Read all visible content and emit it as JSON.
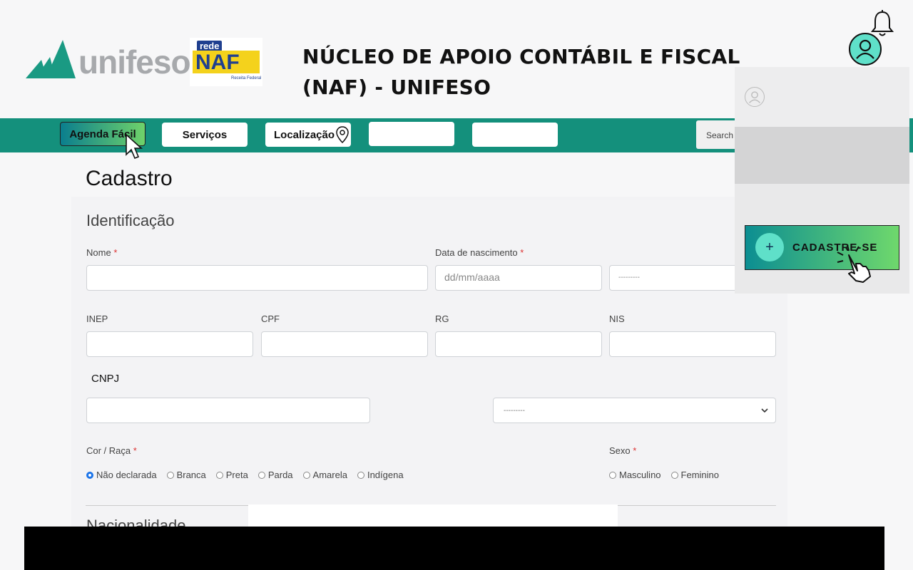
{
  "header": {
    "logo_text": "unifeso",
    "naf_logo_top": "rede",
    "naf_logo_main": "NAF",
    "naf_logo_sub": "Receita Federal",
    "title_line1": "NÚCLEO DE APOIO CONTÁBIL E FISCAL",
    "title_line2": "(NAF) - UNIFESO"
  },
  "nav": {
    "items": [
      "Agenda Fácil",
      "Serviços",
      "Localização",
      "",
      ""
    ],
    "search_placeholder": "Search"
  },
  "form": {
    "page_title": "Cadastro",
    "section_identificacao": "Identificação",
    "labels": {
      "nome": "Nome",
      "data_nascimento": "Data de nascimento",
      "inep": "INEP",
      "cpf": "CPF",
      "rg": "RG",
      "nis": "NIS",
      "cnpj": "CNPJ",
      "cor_raca": "Cor / Raça",
      "sexo": "Sexo"
    },
    "required_marker": "*",
    "date_placeholder": "dd/mm/aaaa",
    "select_placeholder": "---------",
    "cor_raca_options": [
      "Não declarada",
      "Branca",
      "Preta",
      "Parda",
      "Amarela",
      "Indígena"
    ],
    "cor_raca_selected": "Não declarada",
    "sexo_options": [
      "Masculino",
      "Feminino"
    ],
    "section_nacionalidade": "Nacionalidade"
  },
  "panel": {
    "signup_label": "CADASTRE-SE",
    "plus_symbol": "+"
  },
  "colors": {
    "nav_green": "#14907c",
    "accent_teal": "#5fe0c9",
    "radio_blue": "#1a73e8"
  }
}
